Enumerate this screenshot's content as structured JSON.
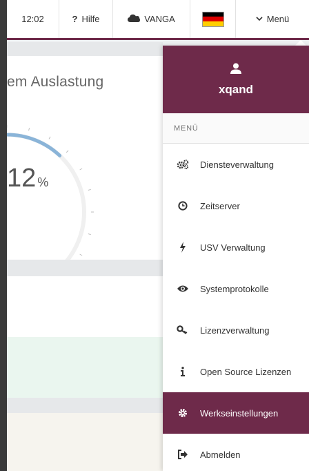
{
  "topbar": {
    "time": "12:02",
    "help_label": "Hilfe",
    "help_symbol": "?",
    "cloud_label": "VANGA",
    "menu_label": "Menü"
  },
  "dashboard": {
    "card_title": "em Auslastung",
    "gauge_value": "12",
    "gauge_unit": "%",
    "gauge_fraction": 0.12
  },
  "menu": {
    "user_name": "xqand",
    "header": "MENÜ",
    "items": [
      {
        "label": "Diensteverwaltung",
        "icon": "cogs-icon"
      },
      {
        "label": "Zeitserver",
        "icon": "clock-icon"
      },
      {
        "label": "USV Verwaltung",
        "icon": "bolt-icon"
      },
      {
        "label": "Systemprotokolle",
        "icon": "eye-icon"
      },
      {
        "label": "Lizenzverwaltung",
        "icon": "key-icon"
      },
      {
        "label": "Open Source Lizenzen",
        "icon": "info-icon"
      },
      {
        "label": "Werkseinstellungen",
        "icon": "gear-icon",
        "active": true
      },
      {
        "label": "Abmelden",
        "icon": "sign-out-icon"
      }
    ]
  },
  "colors": {
    "brand": "#6e2a4a",
    "gauge_track": "#f0f0f0",
    "gauge_fill": "#8ab4d8"
  }
}
